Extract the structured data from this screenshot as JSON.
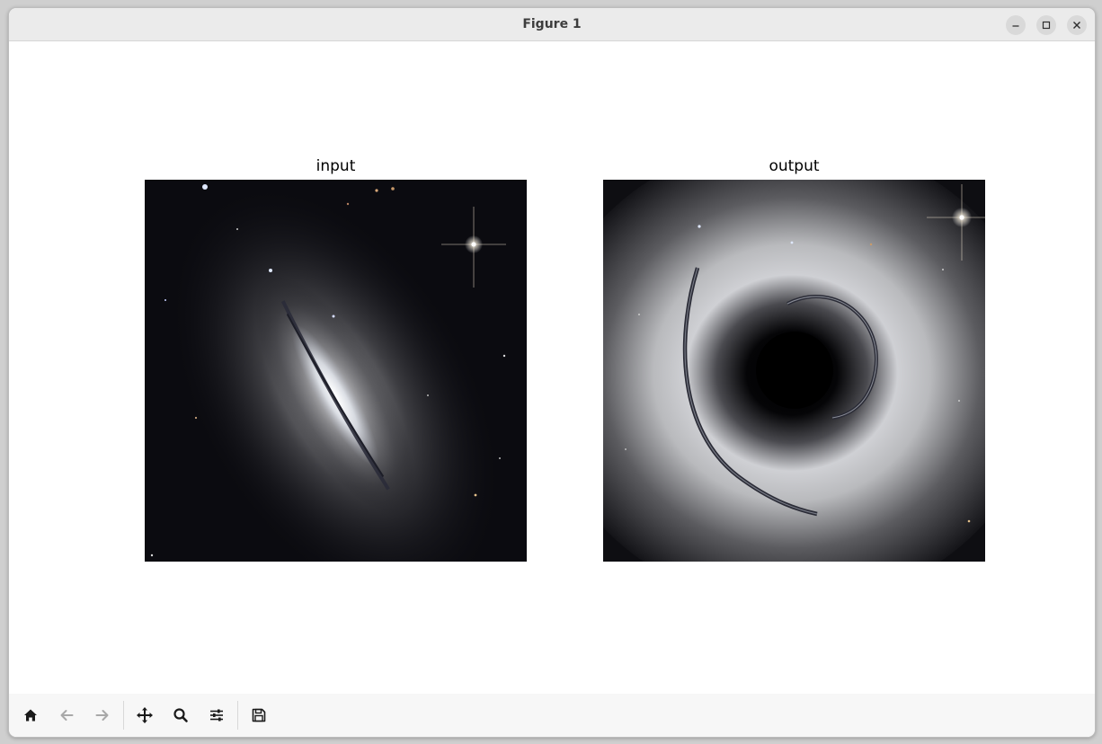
{
  "window": {
    "title": "Figure 1"
  },
  "figure": {
    "axes": [
      {
        "title": "input",
        "image": "edge-on spiral galaxy with dust lane on star field"
      },
      {
        "title": "output",
        "image": "gravitationally lensed galaxy forming ring around black hole shadow"
      }
    ]
  },
  "toolbar": {
    "buttons": [
      {
        "icon": "home-icon",
        "enabled": true
      },
      {
        "icon": "back-arrow-icon",
        "enabled": false
      },
      {
        "icon": "forward-arrow-icon",
        "enabled": false
      },
      {
        "icon": "pan-icon",
        "enabled": true
      },
      {
        "icon": "zoom-icon",
        "enabled": true
      },
      {
        "icon": "configure-subplots-icon",
        "enabled": true
      },
      {
        "icon": "save-icon",
        "enabled": true
      }
    ]
  },
  "colors": {
    "titlebar": "#ebebeb",
    "toolbar": "#f7f7f7",
    "icon": "#1a1a1a",
    "icon_disabled": "#a8a8a8",
    "sky": "#0b0b10"
  }
}
